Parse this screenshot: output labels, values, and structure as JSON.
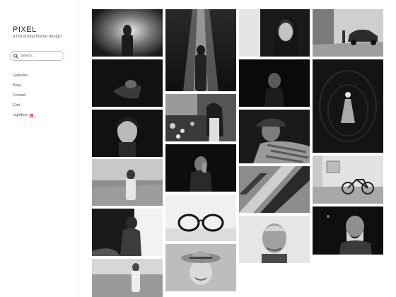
{
  "site": {
    "title": "PIXEL",
    "tagline": "a horizontal theme design"
  },
  "search": {
    "placeholder": "Search..."
  },
  "nav": [
    {
      "label": "Galleries"
    },
    {
      "label": "Blog"
    },
    {
      "label": "Contact"
    },
    {
      "label": "Cart"
    },
    {
      "label": "Lightbox",
      "badge": "0"
    }
  ],
  "photos": [
    {
      "subject": "figure in fog"
    },
    {
      "subject": "person in dark"
    },
    {
      "subject": "portrait of woman"
    },
    {
      "subject": "woman in grass field"
    },
    {
      "subject": "woman silhouette"
    },
    {
      "subject": "woman in field"
    },
    {
      "subject": "figure in light rays"
    },
    {
      "subject": "woman in flower garden"
    },
    {
      "subject": "man with hand to face"
    },
    {
      "subject": "eyeglasses"
    },
    {
      "subject": "child with straw hat"
    },
    {
      "subject": "girl with dark hair"
    },
    {
      "subject": "face in shadow"
    },
    {
      "subject": "old man with hat"
    },
    {
      "subject": "shadow pattern"
    },
    {
      "subject": "elderly man smiling"
    },
    {
      "subject": "man with vintage car"
    },
    {
      "subject": "swimmer in dark water"
    },
    {
      "subject": "bicycle by wall"
    },
    {
      "subject": "old man with beard"
    }
  ],
  "colors": {
    "sidebar_border": "#eeeeee",
    "badge": "#e05a5a"
  }
}
